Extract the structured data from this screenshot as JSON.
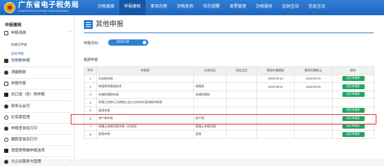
{
  "header": {
    "brand_title": "广东省电子税务局",
    "brand_subtitle": "GUANGDONG ELECTRONIC TAXATION BUREAU",
    "nav": [
      "办税桌面",
      "申报缴税",
      "事项办理",
      "涉税查询",
      "待办提醒",
      "发票管理",
      "办税服务",
      "征纳互动",
      "信息互动"
    ],
    "active_nav_index": 1
  },
  "sidebar": {
    "heading": "申报缴税",
    "group_label": "申报清册",
    "subitems": [
      "按期应申报",
      "其他申报"
    ],
    "active_subitem_index": 1,
    "items": [
      "车购税申报",
      "清缴税款",
      "申报作废",
      "出口退（免）税申报",
      "税务云会司",
      "社保费管理",
      "申报查询及打印",
      "缴款查询及打印",
      "增值税预缴申报选项",
      "大企业服务与管理"
    ]
  },
  "main": {
    "page_title": "其他申报",
    "month_label": "申报月份：",
    "month_value": "2018-06",
    "section_label": "税费申报",
    "table": {
      "headers": [
        "序号",
        "申报表",
        "征收项目",
        "征收品目",
        "税款所属期起",
        "税款所属期止",
        "操作"
      ],
      "rows": [
        [
          "1",
          "印花税申报",
          "",
          "",
          "2018-06-14",
          "2018-06-14",
          "填写申报表"
        ],
        [
          "2",
          "增值税预缴税款表",
          "增值税",
          "",
          "2018-06-01",
          "2018-06-30",
          "填写申报表"
        ],
        [
          "3",
          "车辆购置税申报",
          "车辆购置税",
          "",
          "",
          "",
          "填写申报表"
        ],
        [
          "4",
          "附报已经审汇总纳税企业分支机构年度纳税申报表",
          "",
          "",
          "",
          "",
          ""
        ],
        [
          "5",
          "通用申报",
          "",
          "",
          "",
          "",
          "填写申报表"
        ],
        [
          "6",
          "房产税申报",
          "房产税",
          "",
          "",
          "",
          "填写申报表"
        ],
        [
          "7",
          "城镇土地使用税申报（优化版）",
          "城镇土地使用税",
          "",
          "",
          "",
          "填写申报表"
        ],
        [
          "8",
          "契税申报",
          "契税",
          "",
          "",
          "",
          "填写申报表"
        ]
      ],
      "highlighted_row_index": 4
    }
  },
  "colors": {
    "header_blue": "#2f7fd6",
    "button_green": "#22a463",
    "highlight_red": "#e63030"
  }
}
